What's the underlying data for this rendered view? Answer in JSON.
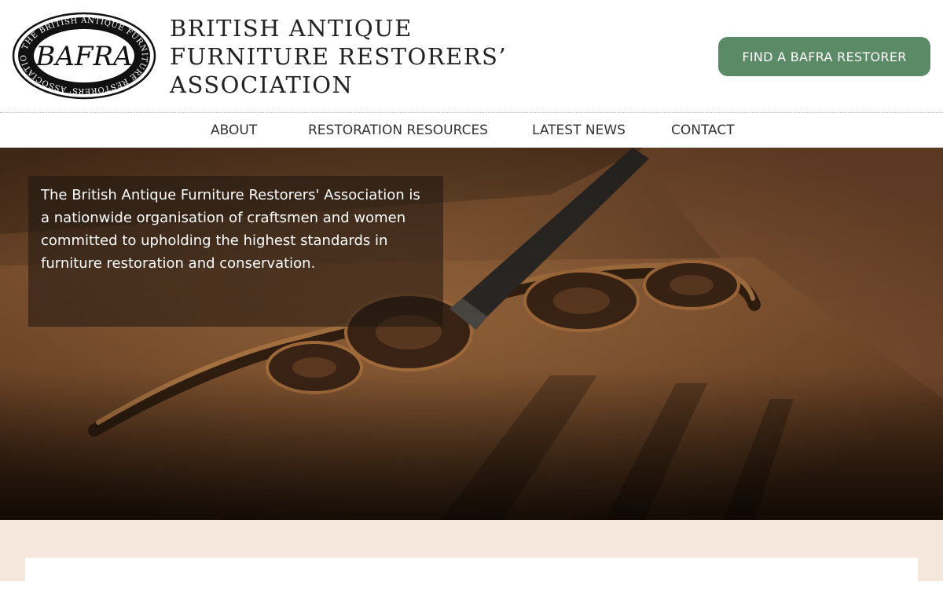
{
  "header": {
    "logo": {
      "monogram": "BAFRA",
      "ring_text": "THE BRITISH ANTIQUE FURNITURE RESTORERS' ASSOCIATION"
    },
    "title_lines": [
      "BRITISH ANTIQUE",
      "FURNITURE RESTORERS’",
      "ASSOCIATION"
    ],
    "cta_label": "FIND A BAFRA RESTORER"
  },
  "nav": {
    "items": [
      {
        "label": "ABOUT"
      },
      {
        "label": "RESTORATION RESOURCES"
      },
      {
        "label": "LATEST NEWS"
      },
      {
        "label": "CONTACT"
      }
    ]
  },
  "hero": {
    "text": "The British Antique Furniture Restorers' Association is a nationwide organisation of craftsmen and women committed to upholding the highest standards in furniture restoration and conservation.",
    "image": "wood-carving-chisel-photo"
  },
  "colors": {
    "accent": "#5b8a67",
    "lower_background": "#f5e7dc",
    "text_dark": "#333333"
  }
}
